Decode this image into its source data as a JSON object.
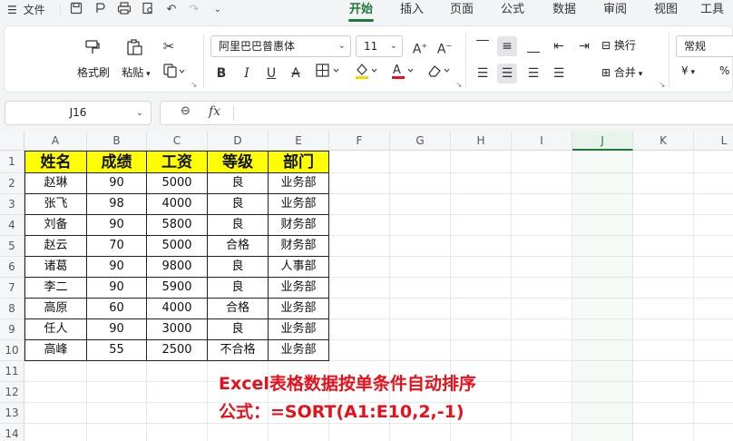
{
  "menubar": {
    "file_label": "文件",
    "tabs": [
      {
        "label": "开始",
        "active": true
      },
      {
        "label": "插入",
        "active": false
      },
      {
        "label": "页面",
        "active": false
      },
      {
        "label": "公式",
        "active": false
      },
      {
        "label": "数据",
        "active": false
      },
      {
        "label": "审阅",
        "active": false
      },
      {
        "label": "视图",
        "active": false
      },
      {
        "label": "工具",
        "active": false
      }
    ]
  },
  "ribbon": {
    "format_painter": "格式刷",
    "paste": "粘贴",
    "font_name": "阿里巴巴普惠体",
    "font_size": "11",
    "wrap_text": "换行",
    "merge": "合并",
    "number_format": "常规",
    "currency_symbol": "¥",
    "percent_symbol": "%"
  },
  "formula_bar": {
    "name_box": "J16",
    "fx": "fx",
    "content": ""
  },
  "grid": {
    "columns": [
      "A",
      "B",
      "C",
      "D",
      "E",
      "F",
      "G",
      "H",
      "I",
      "J",
      "K",
      "L"
    ],
    "selected_column": "J",
    "rows": [
      "1",
      "2",
      "3",
      "4",
      "5",
      "6",
      "7",
      "8",
      "9",
      "10",
      "11",
      "12",
      "13",
      "14"
    ]
  },
  "table": {
    "headers": [
      "姓名",
      "成绩",
      "工资",
      "等级",
      "部门"
    ],
    "rows": [
      [
        "赵琳",
        "90",
        "5000",
        "良",
        "业务部"
      ],
      [
        "张飞",
        "98",
        "4000",
        "良",
        "业务部"
      ],
      [
        "刘备",
        "90",
        "5800",
        "良",
        "财务部"
      ],
      [
        "赵云",
        "70",
        "5000",
        "合格",
        "财务部"
      ],
      [
        "诸葛",
        "90",
        "9800",
        "良",
        "人事部"
      ],
      [
        "李二",
        "90",
        "5900",
        "良",
        "业务部"
      ],
      [
        "高原",
        "60",
        "4000",
        "合格",
        "业务部"
      ],
      [
        "任人",
        "90",
        "3000",
        "良",
        "业务部"
      ],
      [
        "高峰",
        "55",
        "2500",
        "不合格",
        "业务部"
      ]
    ]
  },
  "annotation": {
    "line1": "Excel表格数据按单条件自动排序",
    "line2": "公式：=SORT(A1:E10,2,-1)",
    "color": "#e8101a"
  },
  "colors": {
    "accent": "#1f7a3a",
    "header_fill": "#ffff00"
  }
}
